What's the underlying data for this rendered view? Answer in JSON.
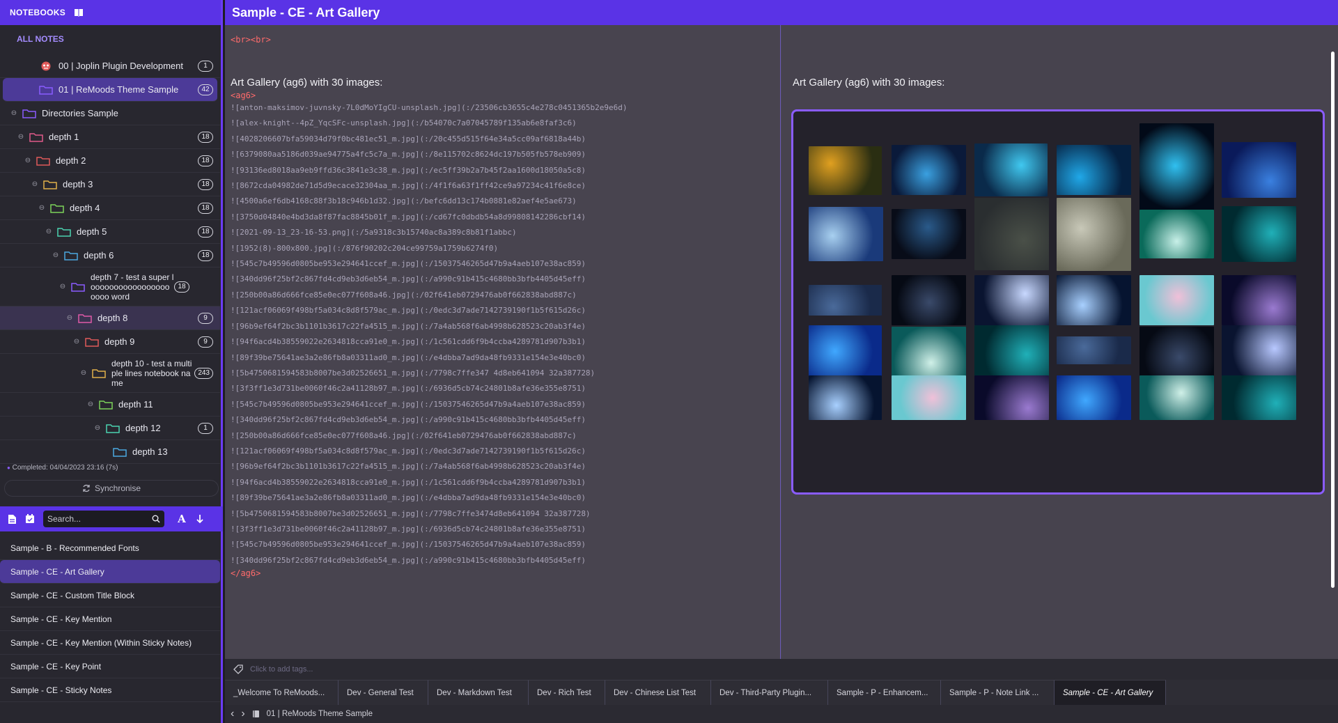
{
  "sidebar": {
    "header_title": "NOTEBOOKS",
    "all_notes": "ALL NOTES",
    "notebooks": [
      {
        "label": "00 | Joplin Plugin Development",
        "count": "1",
        "icon_color": "#e05a5a",
        "icon": "plugin-icon",
        "depth": 0
      },
      {
        "label": "01 | ReMoods Theme Sample",
        "count": "42",
        "icon_color": "#8a5cff",
        "depth": 0
      },
      {
        "label": "Directories Sample",
        "count": "",
        "icon_color": "#8a5cff",
        "depth": 0
      },
      {
        "label": "depth 1",
        "count": "18",
        "icon_color": "#e05a8a",
        "depth": 1
      },
      {
        "label": "depth 2",
        "count": "18",
        "icon_color": "#e05a5a",
        "depth": 2
      },
      {
        "label": "depth 3",
        "count": "18",
        "icon_color": "#e0b04a",
        "depth": 3
      },
      {
        "label": "depth 4",
        "count": "18",
        "icon_color": "#7cd45a",
        "depth": 4
      },
      {
        "label": "depth 5",
        "count": "18",
        "icon_color": "#4ad4b0",
        "depth": 5
      },
      {
        "label": "depth 6",
        "count": "18",
        "icon_color": "#4aa8e0",
        "depth": 6
      },
      {
        "label": "depth 7 - test a super looooooooooooooooooooo word",
        "count": "18",
        "icon_color": "#8a5cff",
        "depth": 7
      },
      {
        "label": "depth 8",
        "count": "9",
        "icon_color": "#e05aa8",
        "depth": 8
      },
      {
        "label": "depth 9",
        "count": "9",
        "icon_color": "#e05a5a",
        "depth": 9
      },
      {
        "label": "depth 10 - test a multiple lines notebook name",
        "count": "243",
        "icon_color": "#e0b04a",
        "depth": 10
      },
      {
        "label": "depth 11",
        "count": "",
        "icon_color": "#7cd45a",
        "depth": 11
      },
      {
        "label": "depth 12",
        "count": "1",
        "icon_color": "#4ad4b0",
        "depth": 12
      },
      {
        "label": "depth 13",
        "count": "",
        "icon_color": "#4aa8e0",
        "depth": 13
      }
    ],
    "sync_status": "Completed: 04/04/2023 23:16 (7s)",
    "sync_button": "Synchronise"
  },
  "note_list": {
    "search_placeholder": "Search...",
    "sort_label": "A",
    "notes": [
      "Sample - B - Recommended Fonts",
      "Sample - CE - Art Gallery",
      "Sample - CE - Custom Title Block",
      "Sample - CE - Key Mention",
      "Sample - CE - Key Mention (Within Sticky Notes)",
      "Sample - CE - Key Point",
      "Sample - CE - Sticky Notes"
    ]
  },
  "note": {
    "title": "Sample - CE - Art Gallery",
    "br_line": "<br><br>",
    "gallery_heading": "Art Gallery (ag6) with 30 images:",
    "open_tag": "<ag6>",
    "close_tag": "</ag6>",
    "markdown_lines": [
      "![anton-maksimov-juvnsky-7L0dMoYIgCU-unsplash.jpg](:/23506cb3655c4e278c0451365b2e9e6d)",
      "![alex-knight--4pZ_YqcSFc-unsplash.jpg](:/b54070c7a07045789f135ab6e8faf3c6)",
      "![4028206607bfa59034d79f0bc481ec51_m.jpg](:/20c455d515f64e34a5cc09af6818a44b)",
      "![6379080aa5186d039ae94775a4fc5c7a_m.jpg](:/8e115702c8624dc197b505fb578eb909)",
      "![93136ed8018aa9eb9ffd36c3841e3c38_m.jpg](:/ec5ff39b2a7b45f2aa1600d18050a5c8)",
      "![8672cda04982de71d5d9ecace32304aa_m.jpg](:/4f1f6a63f1ff42ce9a97234c41f6e8ce)",
      "![4500a6ef6db4168c88f3b18c946b1d32.jpg](:/befc6dd13c174b0881e82aef4e5ae673)",
      "![3750d04840e4bd3da8f87fac8845b01f_m.jpg](:/cd67fc0dbdb54a8d99808142286cbf14)",
      "![2021-09-13_23-16-53.png](:/5a9318c3b15740ac8a389c8b81f1abbc)",
      "![1952(8)-800x800.jpg](:/876f90202c204ce99759a1759b6274f0)",
      "![545c7b49596d0805be953e294641ccef_m.jpg](:/15037546265d47b9a4aeb107e38ac859)",
      "![340dd96f25bf2c867fd4cd9eb3d6eb54_m.jpg](:/a990c91b415c4680bb3bfb4405d45eff)",
      "![250b00a86d666fce85e0ec077f608a46.jpg](:/02f641eb0729476ab0f662838abd887c)",
      "![121acf06069f498bf5a034c8d8f579ac_m.jpg](:/0edc3d7ade7142739190f1b5f615d26c)",
      "![96b9ef64f2bc3b1101b3617c22fa4515_m.jpg](:/7a4ab568f6ab4998b628523c20ab3f4e)",
      "![94f6acd4b38559022e2634818cca91e0_m.jpg](:/1c561cdd6f9b4ccba4289781d907b3b1)",
      "![89f39be75641ae3a2e86fb8a03311ad0_m.jpg](:/e4dbba7ad9da48fb9331e154e3e40bc0)",
      "![5b4750681594583b8007be3d02526651_m.jpg](:/7798c7ffe347 4d8eb641094 32a387728)",
      "![3f3ff1e3d731be0060f46c2a41128b97_m.jpg](:/6936d5cb74c24801b8afe36e355e8751)",
      "![545c7b49596d0805be953e294641ccef_m.jpg](:/15037546265d47b9a4aeb107e38ac859)",
      "![340dd96f25bf2c867fd4cd9eb3d6eb54_m.jpg](:/a990c91b415c4680bb3bfb4405d45eff)",
      "![250b00a86d666fce85e0ec077f608a46.jpg](:/02f641eb0729476ab0f662838abd887c)",
      "![121acf06069f498bf5a034c8d8f579ac_m.jpg](:/0edc3d7ade7142739190f1b5f615d26c)",
      "![96b9ef64f2bc3b1101b3617c22fa4515_m.jpg](:/7a4ab568f6ab4998b628523c20ab3f4e)",
      "![94f6acd4b38559022e2634818cca91e0_m.jpg](:/1c561cdd6f9b4ccba4289781d907b3b1)",
      "![89f39be75641ae3a2e86fb8a03311ad0_m.jpg](:/e4dbba7ad9da48fb9331e154e3e40bc0)",
      "![5b4750681594583b8007be3d02526651_m.jpg](:/7798c7ffe3474d8eb641094 32a387728)",
      "![3f3ff1e3d731be0060f46c2a41128b97_m.jpg](:/6936d5cb74c24801b8afe36e355e8751)",
      "![545c7b49596d0805be953e294641ccef_m.jpg](:/15037546265d47b9a4aeb107e38ac859)",
      "![340dd96f25bf2c867fd4cd9eb3d6eb54_m.jpg](:/a990c91b415c4680bb3bfb4405d45eff)"
    ],
    "gallery_thumbs": [
      {
        "c1": "#2a2e12",
        "c2": "#e0a020"
      },
      {
        "c1": "#0a1a3a",
        "c2": "#3aa0e0"
      },
      {
        "c1": "#0a2a4a",
        "c2": "#40c8f0"
      },
      {
        "c1": "#052040",
        "c2": "#20a8e8"
      },
      {
        "c1": "#020a18",
        "c2": "#30c0f0"
      },
      {
        "c1": "#0a1a5a",
        "c2": "#3a80e0"
      },
      {
        "c1": "#1a3a7a",
        "c2": "#a8d0f0"
      },
      {
        "c1": "#080c18",
        "c2": "#2a5a8a"
      },
      {
        "c1": "#2a2e30",
        "c2": "#4a5048"
      },
      {
        "c1": "#6a6a5a",
        "c2": "#c8c8b8"
      },
      {
        "c1": "#0a6a5a",
        "c2": "#c8f0e8"
      },
      {
        "c1": "#002a30",
        "c2": "#20b0b8"
      },
      {
        "c1": "#1a2a4a",
        "c2": "#4a6a9a"
      },
      {
        "c1": "#060a14",
        "c2": "#3a4a6a"
      },
      {
        "c1": "#0a1430",
        "c2": "#c8d8ff"
      },
      {
        "c1": "#061430",
        "c2": "#a8d0ff"
      },
      {
        "c1": "#6ac8d0",
        "c2": "#f0c0d8"
      },
      {
        "c1": "#0a0a2a",
        "c2": "#9a7ad0"
      },
      {
        "c1": "#0a2a8a",
        "c2": "#40a8ff"
      },
      {
        "c1": "#0a5a5a",
        "c2": "#d0f0e8"
      },
      {
        "c1": "#002a30",
        "c2": "#20b0b8"
      },
      {
        "c1": "#1a2a4a",
        "c2": "#4a6a9a"
      },
      {
        "c1": "#060a14",
        "c2": "#3a4a6a"
      },
      {
        "c1": "#0a1430",
        "c2": "#b8c8ff"
      },
      {
        "c1": "#061430",
        "c2": "#a8d0ff"
      },
      {
        "c1": "#6ac8d0",
        "c2": "#f0c0d8"
      },
      {
        "c1": "#0a0a2a",
        "c2": "#9a7ad0"
      },
      {
        "c1": "#0a2a8a",
        "c2": "#40a8ff"
      },
      {
        "c1": "#0a5a5a",
        "c2": "#d0f0e8"
      },
      {
        "c1": "#002a30",
        "c2": "#20b0b8"
      }
    ]
  },
  "tags": {
    "placeholder": "Click to add tags..."
  },
  "tabs": [
    "_Welcome To ReMoods...",
    "Dev - General Test",
    "Dev - Markdown Test",
    "Dev - Rich Test",
    "Dev - Chinese List Test",
    "Dev - Third-Party Plugin...",
    "Sample - P - Enhancem...",
    "Sample - P - Note Link ...",
    "Sample - CE - Art Gallery"
  ],
  "status": {
    "notebook": "01 | ReMoods Theme Sample"
  },
  "colors": {
    "accent": "#5a33e6",
    "tag_red": "#ff6b6b",
    "gallery_border": "#8a5cff"
  }
}
